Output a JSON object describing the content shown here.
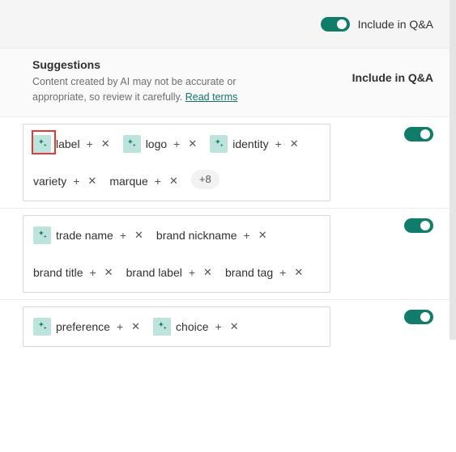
{
  "top": {
    "include_label": "Include in Q&A",
    "toggle_on": true
  },
  "header": {
    "title": "Suggestions",
    "desc_prefix": "Content created by AI may not be accurate or appropriate, so review it carefully. ",
    "read_terms": "Read terms",
    "right_label": "Include in Q&A"
  },
  "glyphs": {
    "plus": "+",
    "x": "✕"
  },
  "groups": [
    {
      "highlight_first_icon": true,
      "toggle_on": true,
      "items": [
        {
          "text": "label",
          "ai": true
        },
        {
          "text": "logo",
          "ai": true
        },
        {
          "text": "identity",
          "ai": true
        },
        {
          "text": "variety",
          "ai": false
        },
        {
          "text": "marque",
          "ai": false
        }
      ],
      "overflow": "+8"
    },
    {
      "highlight_first_icon": false,
      "toggle_on": true,
      "items": [
        {
          "text": "trade name",
          "ai": true
        },
        {
          "text": "brand nickname",
          "ai": false
        },
        {
          "text": "brand title",
          "ai": false
        },
        {
          "text": "brand label",
          "ai": false
        },
        {
          "text": "brand tag",
          "ai": false
        }
      ],
      "overflow": null
    },
    {
      "highlight_first_icon": false,
      "toggle_on": true,
      "items": [
        {
          "text": "preference",
          "ai": true
        },
        {
          "text": "choice",
          "ai": true
        }
      ],
      "overflow": null
    }
  ]
}
